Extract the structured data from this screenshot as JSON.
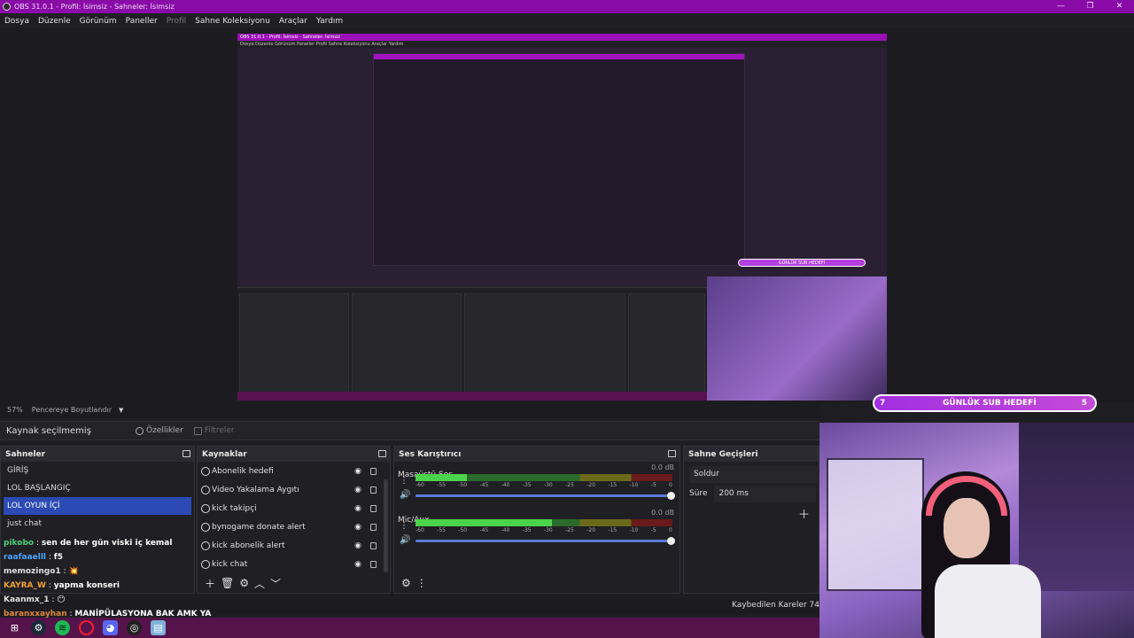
{
  "window": {
    "title": "OBS 31.0.1 - Profil: İsimsiz - Sahneler: İsimsiz",
    "controls": [
      "—",
      "❐",
      "✕"
    ]
  },
  "menu": {
    "items": [
      "Dosya",
      "Düzenle",
      "Görünüm",
      "Paneller",
      "Profil",
      "Sahne Koleksiyonu",
      "Araçlar",
      "Yardım"
    ]
  },
  "preview": {
    "zoom": "57%",
    "mode": "Pencereye Boyutlandır",
    "nested_title": "OBS 31.0.1 - Profil: İsimsiz - Sahneler: İsimsiz",
    "nested_menu": "Dosya   Düzenle   Görünüm   Paneller   Profil   Sahne Koleksiyonu   Araçlar   Yardım",
    "nested_goal": "GÜNLÜK SUB HEDEFİ"
  },
  "source_toolbar": {
    "no_source": "Kaynak seçilmemiş",
    "properties": "Özellikler",
    "filters": "Filtreler"
  },
  "scenes": {
    "title": "Sahneler",
    "items": [
      "GİRİŞ",
      "LOL BAŞLANGIÇ",
      "LOL OYUN İÇİ",
      "just chat"
    ],
    "active_index": 2
  },
  "sources": {
    "title": "Kaynaklar",
    "items": [
      "Abonelik hedefi",
      "Video Yakalama Aygıtı",
      "kick takipçi",
      "bynogame donate alert",
      "kick abonelik alert",
      "kick chat"
    ]
  },
  "mixer": {
    "title": "Ses Karıştırıcı",
    "channels": [
      {
        "name": "Masaüstü Ses",
        "db": "0.0 dB",
        "level": 0.2
      },
      {
        "name": "Mic/Aux",
        "db": "0.0 dB",
        "level": 0.53
      }
    ],
    "scale": [
      "-60",
      "-55",
      "-50",
      "-45",
      "-40",
      "-35",
      "-30",
      "-25",
      "-20",
      "-15",
      "-10",
      "-5",
      "0"
    ]
  },
  "transitions": {
    "title": "Sahne Geçişleri",
    "selected": "Soldur",
    "duration_label": "Süre",
    "duration_value": "200 ms"
  },
  "chat": [
    {
      "user": "pikobo",
      "user_color": "#4bd17a",
      "msg": "sen de her gün viski iç kemal"
    },
    {
      "user": "raafaaelll",
      "user_color": "#4aa6ff",
      "msg": "f5"
    },
    {
      "user": "memozingo1",
      "user_color": "#e0e0e0",
      "msg": "💥"
    },
    {
      "user": "KAYRA_W",
      "user_color": "#f0a030",
      "msg": "yapma konseri"
    },
    {
      "user": "Kaanmx_1",
      "user_color": "#e0e0e0",
      "msg": "😶"
    },
    {
      "user": "baranxxayhan",
      "user_color": "#e08a3a",
      "msg": "MANİPÜLASYONA BAK AMK YA"
    }
  ],
  "status": {
    "dropped_frames": "Kaybedilen Kareler 74"
  },
  "subgoal": {
    "current": "7",
    "label": "GÜNLÜK SUB HEDEFİ",
    "target": "5"
  },
  "taskbar": {
    "apps": [
      "windows-start",
      "steam",
      "spotify",
      "opera",
      "discord",
      "obs",
      "notes"
    ]
  },
  "colors": {
    "title_bar": "#8a0aa8",
    "active_scene": "#2b4ab4",
    "subgoal": "#a12fe0"
  }
}
